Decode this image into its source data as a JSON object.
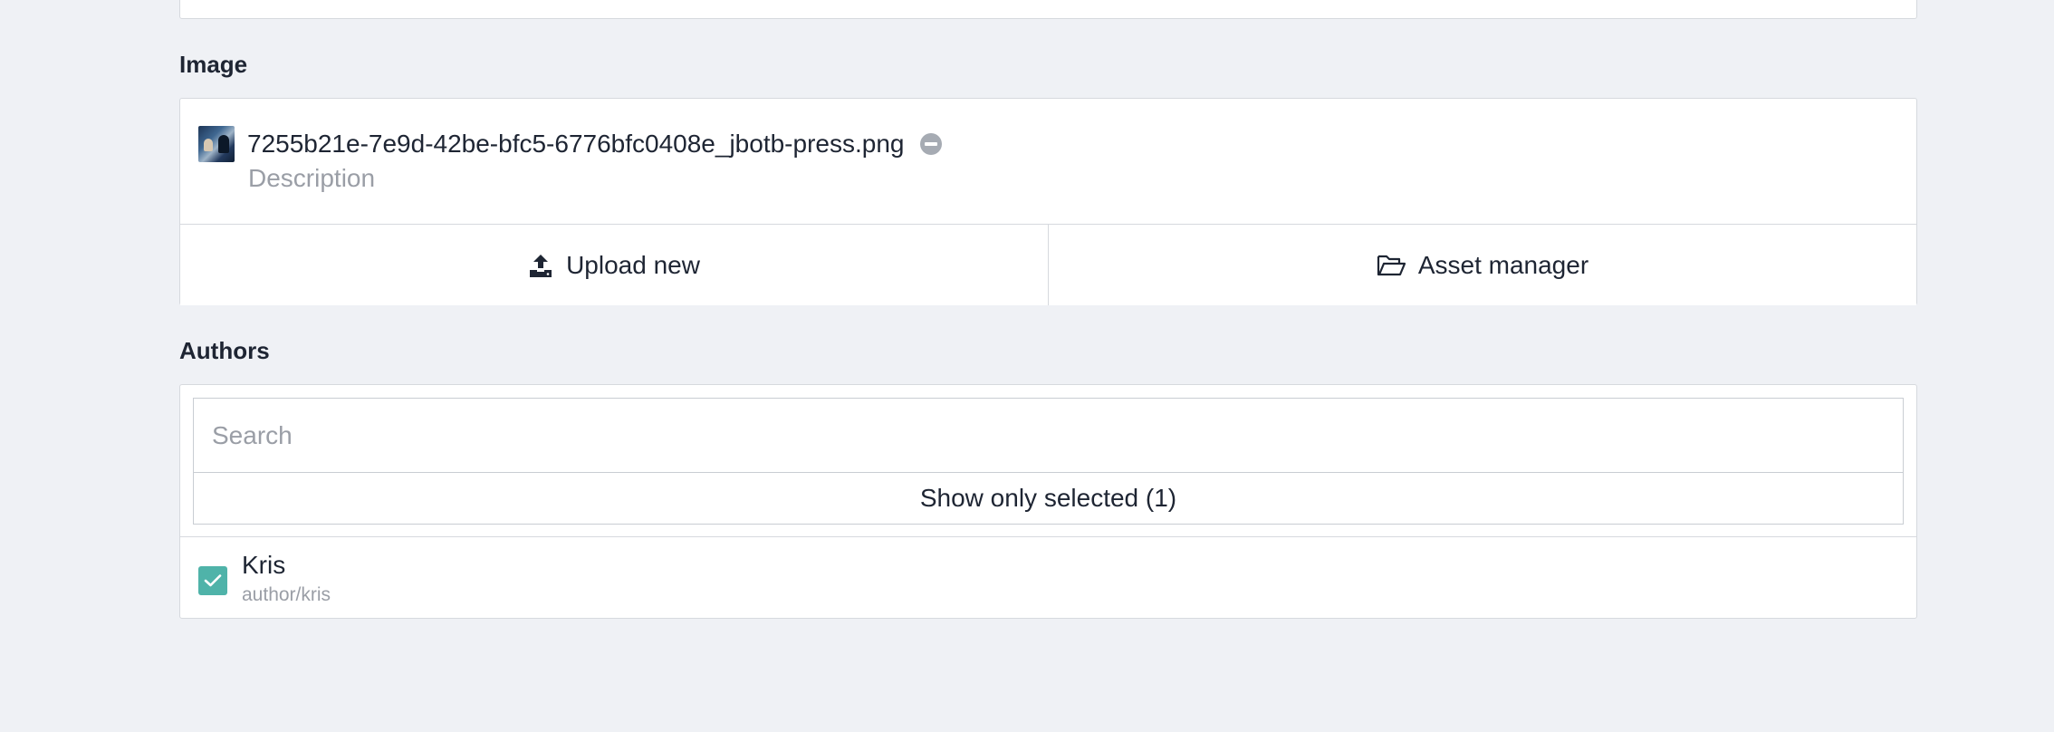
{
  "image_section": {
    "label": "Image",
    "filename": "7255b21e-7e9d-42be-bfc5-6776bfc0408e_jbotb-press.png",
    "description_placeholder": "Description",
    "upload_label": "Upload new",
    "asset_manager_label": "Asset manager"
  },
  "authors_section": {
    "label": "Authors",
    "search_placeholder": "Search",
    "show_selected_label": "Show only selected (1)",
    "items": [
      {
        "name": "Kris",
        "slug": "author/kris",
        "checked": true
      }
    ]
  },
  "colors": {
    "background": "#eff1f5",
    "checkbox_accent": "#4fb3a9",
    "remove_icon": "#a6abb3"
  },
  "icons": {
    "upload": "upload-icon",
    "asset_manager": "folder-open-icon",
    "remove": "minus-circle-icon",
    "check": "check-icon"
  }
}
